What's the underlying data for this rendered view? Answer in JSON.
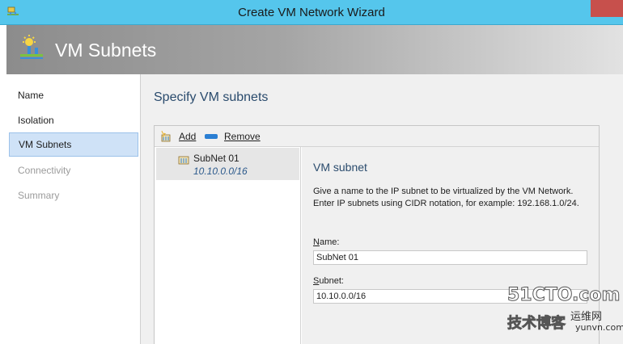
{
  "window": {
    "title": "Create VM Network Wizard"
  },
  "banner": {
    "title": "VM Subnets",
    "icon": "vm-network-icon"
  },
  "sidebar": {
    "items": [
      {
        "label": "Name",
        "state": "normal"
      },
      {
        "label": "Isolation",
        "state": "normal"
      },
      {
        "label": "VM Subnets",
        "state": "active"
      },
      {
        "label": "Connectivity",
        "state": "disabled"
      },
      {
        "label": "Summary",
        "state": "disabled"
      }
    ]
  },
  "main": {
    "title": "Specify VM subnets",
    "toolbar": {
      "add_label": "Add",
      "remove_label": "Remove"
    },
    "subnets": [
      {
        "name": "SubNet 01",
        "cidr": "10.10.0.0/16"
      }
    ],
    "detail": {
      "title": "VM subnet",
      "description": "Give a name to the IP subnet to be virtualized by the VM Network. Enter IP subnets using CIDR notation, for example: 192.168.1.0/24.",
      "name_label_accel": "N",
      "name_label_rest": "ame:",
      "name_value": "SubNet 01",
      "subnet_label_accel": "S",
      "subnet_label_rest": "ubnet:",
      "subnet_value": "10.10.0.0/16"
    }
  },
  "watermark": {
    "top": "51CTO.com",
    "left": "技术博客",
    "right": "运维网",
    "url": "yunvn.com"
  },
  "colors": {
    "titlebar": "#55c6ec",
    "close": "#c7504c",
    "active_nav": "#cfe2f7",
    "heading": "#2a4b6d"
  }
}
